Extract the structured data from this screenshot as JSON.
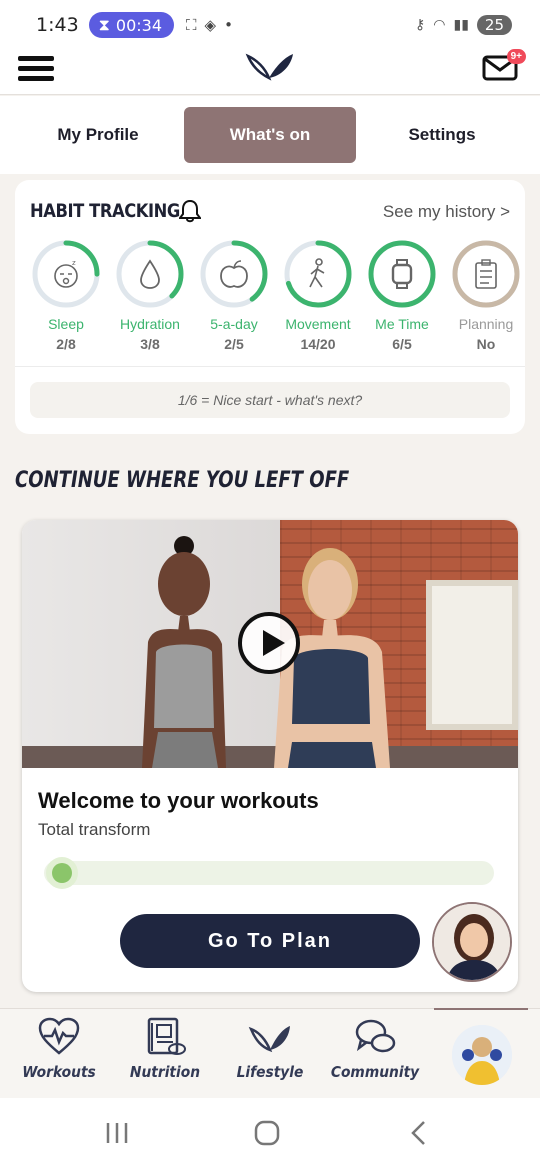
{
  "status_bar": {
    "time": "1:43",
    "timer": "00:34",
    "battery": "25"
  },
  "app_bar": {
    "mail_badge": "9+"
  },
  "tabs": [
    {
      "label": "My Profile",
      "active": false
    },
    {
      "label": "What's on",
      "active": true
    },
    {
      "label": "Settings",
      "active": false
    }
  ],
  "habit_tracking": {
    "title": "HABIT TRACKING",
    "history_link": "See my history >",
    "habits": [
      {
        "label": "Sleep",
        "value": "2/8",
        "progress": 0.25,
        "icon": "sleep-face-icon"
      },
      {
        "label": "Hydration",
        "value": "3/8",
        "progress": 0.375,
        "icon": "water-drop-icon"
      },
      {
        "label": "5-a-day",
        "value": "2/5",
        "progress": 0.4,
        "icon": "apple-icon"
      },
      {
        "label": "Movement",
        "value": "14/20",
        "progress": 0.7,
        "icon": "walking-person-icon"
      },
      {
        "label": "Me Time",
        "value": "6/5",
        "progress": 1.0,
        "icon": "smartwatch-icon"
      },
      {
        "label": "Planning",
        "value": "No",
        "progress": 1.0,
        "icon": "clipboard-icon"
      }
    ],
    "summary": "1/6 = Nice start - what's next?"
  },
  "continue_section": {
    "title": "CONTINUE WHERE YOU LEFT OFF"
  },
  "workout_card": {
    "title": "Welcome to your workouts",
    "subtitle": "Total transform",
    "progress": 0.03,
    "button_label": "Go To Plan"
  },
  "bottom_nav": [
    {
      "label": "Workouts",
      "icon": "heart-pulse-icon"
    },
    {
      "label": "Nutrition",
      "icon": "recipe-book-icon"
    },
    {
      "label": "Lifestyle",
      "icon": "leaf-icon"
    },
    {
      "label": "Community",
      "icon": "chat-bubbles-icon"
    }
  ],
  "colors": {
    "accent_tab": "#8e7474",
    "ring_green": "#3cb46e",
    "ring_track": "#dfe6ec",
    "planning_ring": "#c8b8a6",
    "button_dark": "#1f2640"
  }
}
